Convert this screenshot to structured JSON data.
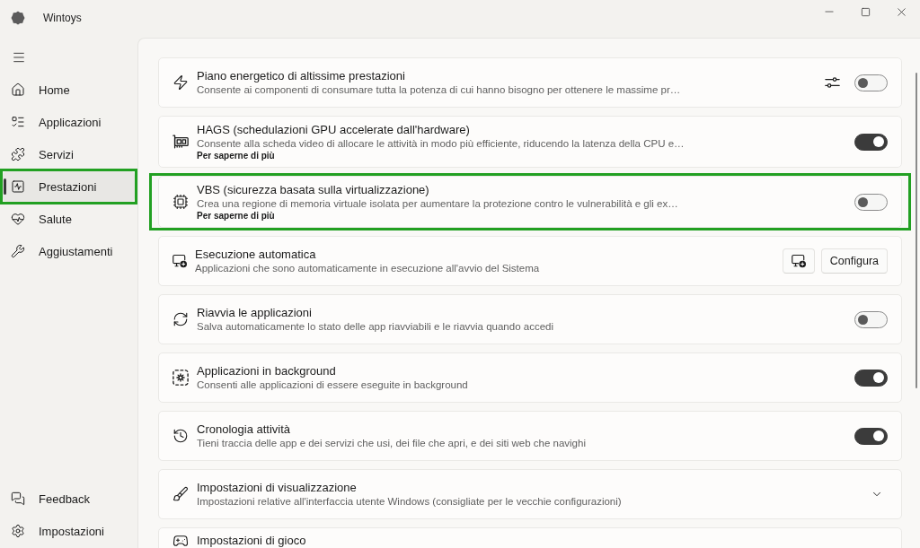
{
  "window": {
    "title": "Wintoys"
  },
  "sidebar": {
    "items": [
      {
        "label": "Home",
        "selected": false,
        "highlighted": false
      },
      {
        "label": "Applicazioni",
        "selected": false,
        "highlighted": false
      },
      {
        "label": "Servizi",
        "selected": false,
        "highlighted": false
      },
      {
        "label": "Prestazioni",
        "selected": true,
        "highlighted": true
      },
      {
        "label": "Salute",
        "selected": false,
        "highlighted": false
      },
      {
        "label": "Aggiustamenti",
        "selected": false,
        "highlighted": false
      }
    ],
    "footer_items": [
      {
        "label": "Feedback",
        "selected": false
      },
      {
        "label": "Impostazioni",
        "selected": false
      }
    ]
  },
  "settings": [
    {
      "kind": "toggle",
      "title": "Piano energetico di altissime prestazioni",
      "description": "Consente ai componenti di consumare tutta la potenza di cui hanno bisogno per ottenere le massime pr…",
      "on": false,
      "options": true,
      "highlighted": false
    },
    {
      "kind": "toggle",
      "title": "HAGS (schedulazioni GPU accelerate dall'hardware)",
      "description": "Consente alla scheda video di allocare le attività in modo più efficiente, riducendo la latenza della CPU e…",
      "link": "Per saperne di più",
      "on": true,
      "options": false,
      "highlighted": false
    },
    {
      "kind": "toggle",
      "title": "VBS (sicurezza basata sulla virtualizzazione)",
      "description": "Crea una regione di memoria virtuale isolata per aumentare la protezione contro le vulnerabilità e gli ex…",
      "link": "Per saperne di più",
      "on": false,
      "options": false,
      "highlighted": true
    },
    {
      "kind": "buttons",
      "title": "Esecuzione automatica",
      "description": "Applicazioni che sono automaticamente in esecuzione all'avvio del Sistema",
      "button_label": "Configura",
      "options": false,
      "highlighted": false
    },
    {
      "kind": "toggle",
      "title": "Riavvia le applicazioni",
      "description": "Salva automaticamente lo stato delle app riavviabili e le riavvia quando accedi",
      "on": false,
      "options": false,
      "highlighted": false
    },
    {
      "kind": "toggle",
      "title": "Applicazioni in background",
      "description": "Consenti alle applicazioni di essere eseguite in background",
      "on": true,
      "options": false,
      "highlighted": false
    },
    {
      "kind": "toggle",
      "title": "Cronologia attività",
      "description": "Tieni traccia delle app e dei servizi che usi, dei file che apri, e dei siti web che navighi",
      "on": true,
      "options": false,
      "highlighted": false
    },
    {
      "kind": "expander",
      "title": "Impostazioni di visualizzazione",
      "description": "Impostazioni relative all'interfaccia utente Windows (consigliate per le vecchie configurazioni)",
      "expanded": false,
      "options": false,
      "highlighted": false
    },
    {
      "title": "Impostazioni di gioco",
      "options": false,
      "highlighted": false
    }
  ]
}
